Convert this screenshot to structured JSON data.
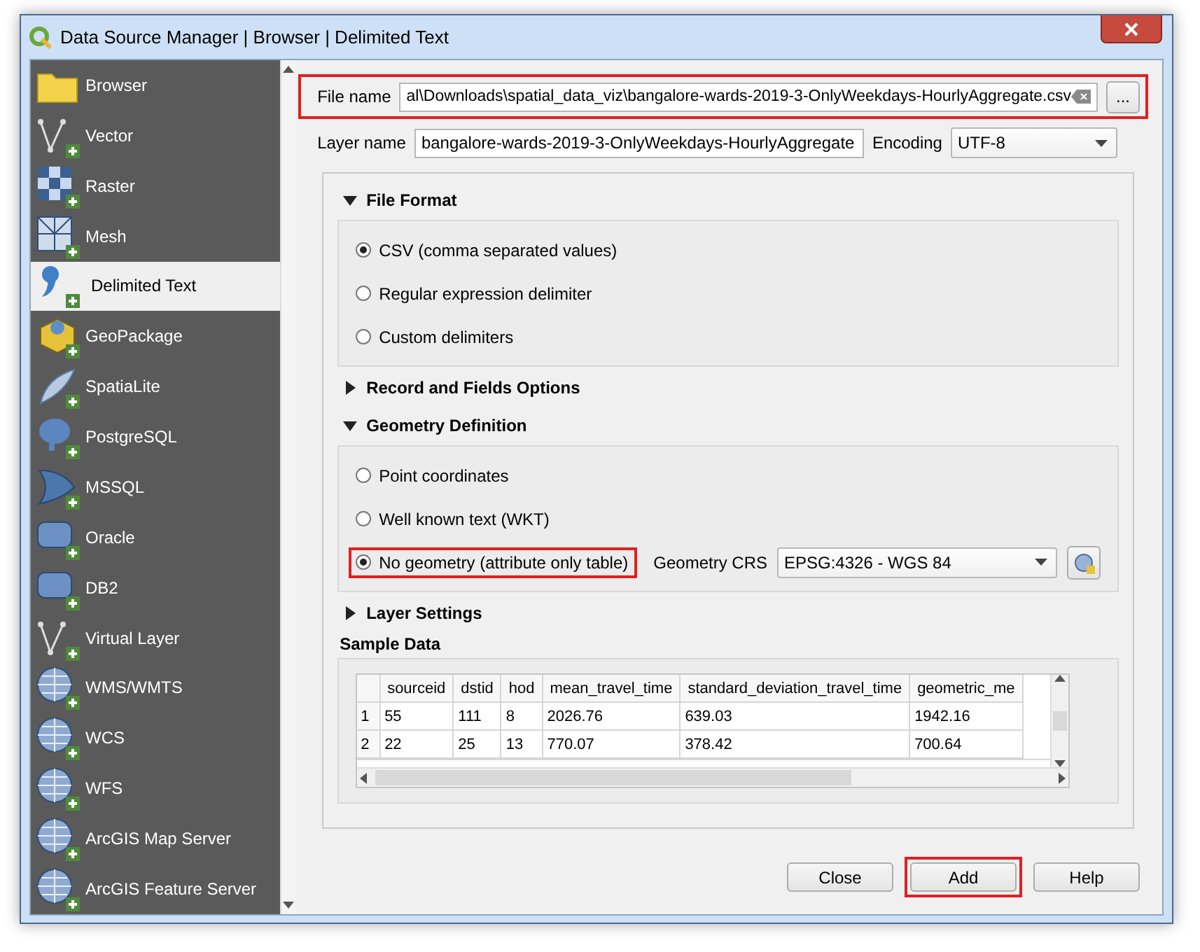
{
  "window": {
    "title": "Data Source Manager | Browser | Delimited Text"
  },
  "sidebar": {
    "items": [
      {
        "label": "Browser",
        "kind": "folder",
        "selected": false
      },
      {
        "label": "Vector",
        "kind": "vector",
        "selected": false
      },
      {
        "label": "Raster",
        "kind": "raster",
        "selected": false
      },
      {
        "label": "Mesh",
        "kind": "mesh",
        "selected": false
      },
      {
        "label": "Delimited Text",
        "kind": "comma",
        "selected": true
      },
      {
        "label": "GeoPackage",
        "kind": "cube",
        "selected": false
      },
      {
        "label": "SpatiaLite",
        "kind": "feather",
        "selected": false
      },
      {
        "label": "PostgreSQL",
        "kind": "database",
        "selected": false
      },
      {
        "label": "MSSQL",
        "kind": "sail",
        "selected": false
      },
      {
        "label": "Oracle",
        "kind": "rounded",
        "selected": false
      },
      {
        "label": "DB2",
        "kind": "rounded",
        "selected": false
      },
      {
        "label": "Virtual Layer",
        "kind": "vector",
        "selected": false
      },
      {
        "label": "WMS/WMTS",
        "kind": "globe",
        "selected": false
      },
      {
        "label": "WCS",
        "kind": "globe",
        "selected": false
      },
      {
        "label": "WFS",
        "kind": "globe",
        "selected": false
      },
      {
        "label": "ArcGIS Map Server",
        "kind": "globe",
        "selected": false
      },
      {
        "label": "ArcGIS Feature Server",
        "kind": "globe",
        "selected": false
      }
    ]
  },
  "file_name": {
    "label": "File name",
    "value": "al\\Downloads\\spatial_data_viz\\bangalore-wards-2019-3-OnlyWeekdays-HourlyAggregate.csv",
    "browse_button": "...",
    "highlighted": true
  },
  "layer_name": {
    "label": "Layer name",
    "value": "bangalore-wards-2019-3-OnlyWeekdays-HourlyAggregate"
  },
  "encoding": {
    "label": "Encoding",
    "value": "UTF-8"
  },
  "sections": [
    {
      "title": "File Format",
      "expanded": true,
      "options": [
        {
          "label": "CSV (comma separated values)",
          "selected": true,
          "highlighted": false
        },
        {
          "label": "Regular expression delimiter",
          "selected": false,
          "highlighted": false
        },
        {
          "label": "Custom delimiters",
          "selected": false,
          "highlighted": false
        }
      ]
    },
    {
      "title": "Record and Fields Options",
      "expanded": false
    },
    {
      "title": "Geometry Definition",
      "expanded": true,
      "options": [
        {
          "label": "Point coordinates",
          "selected": false,
          "highlighted": false
        },
        {
          "label": "Well known text (WKT)",
          "selected": false,
          "highlighted": false
        },
        {
          "label": "No geometry (attribute only table)",
          "selected": true,
          "highlighted": true
        }
      ],
      "crs": {
        "label": "Geometry CRS",
        "value": "EPSG:4326 - WGS 84"
      }
    },
    {
      "title": "Layer Settings",
      "expanded": false
    }
  ],
  "sample_data": {
    "title": "Sample Data",
    "columns": [
      "sourceid",
      "dstid",
      "hod",
      "mean_travel_time",
      "standard_deviation_travel_time",
      "geometric_me"
    ],
    "rows": [
      {
        "index": "1",
        "cells": [
          "55",
          "111",
          "8",
          "2026.76",
          "639.03",
          "1942.16"
        ]
      },
      {
        "index": "2",
        "cells": [
          "22",
          "25",
          "13",
          "770.07",
          "378.42",
          "700.64"
        ]
      }
    ]
  },
  "buttons": [
    {
      "label": "Close",
      "highlighted": false
    },
    {
      "label": "Add",
      "highlighted": true
    },
    {
      "label": "Help",
      "highlighted": false
    }
  ]
}
